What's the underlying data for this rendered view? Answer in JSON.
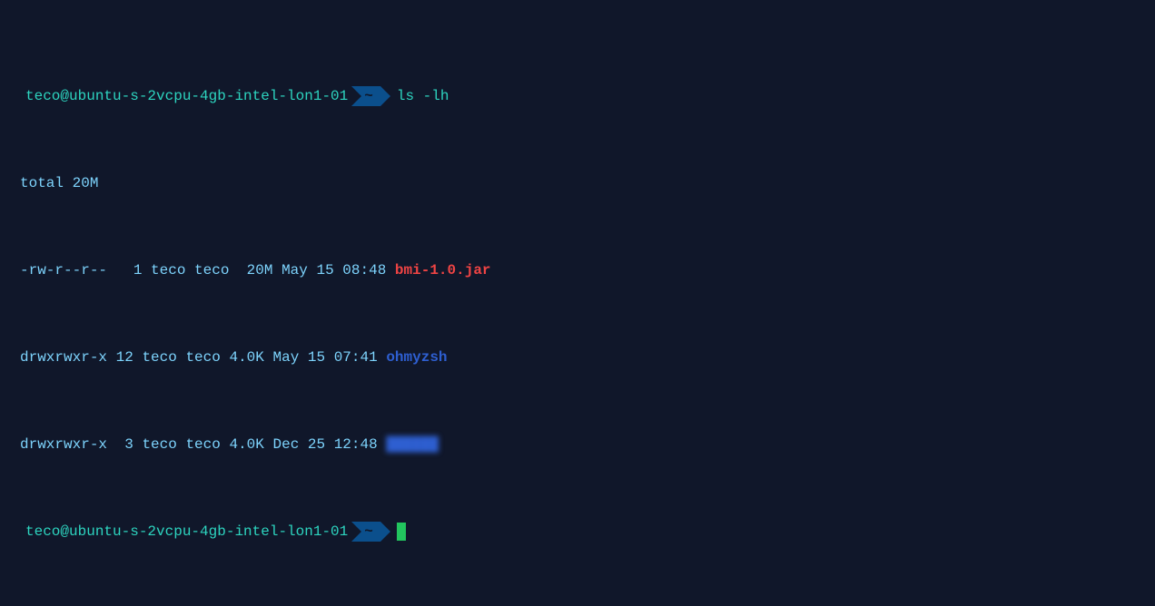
{
  "prompt": {
    "user_host": "teco@ubuntu-s-2vcpu-4gb-intel-lon1-01",
    "cwd": "~",
    "command": "ls -lh"
  },
  "output": {
    "total": "total 20M",
    "rows": [
      {
        "perm": "-rw-r--r--",
        "links": " 1",
        "owner": "teco",
        "group": "teco",
        "size": " 20M",
        "date": "May 15 08:48",
        "name": "bmi-1.0.jar",
        "color": "red"
      },
      {
        "perm": "drwxrwxr-x",
        "links": "12",
        "owner": "teco",
        "group": "teco",
        "size": "4.0K",
        "date": "May 15 07:41",
        "name": "ohmyzsh",
        "color": "blue"
      },
      {
        "perm": "drwxrwxr-x",
        "links": " 3",
        "owner": "teco",
        "group": "teco",
        "size": "4.0K",
        "date": "Dec 25 12:48",
        "name": "██████",
        "color": "blurred"
      }
    ]
  },
  "prompt2": {
    "user_host": "teco@ubuntu-s-2vcpu-4gb-intel-lon1-01",
    "cwd": "~"
  }
}
